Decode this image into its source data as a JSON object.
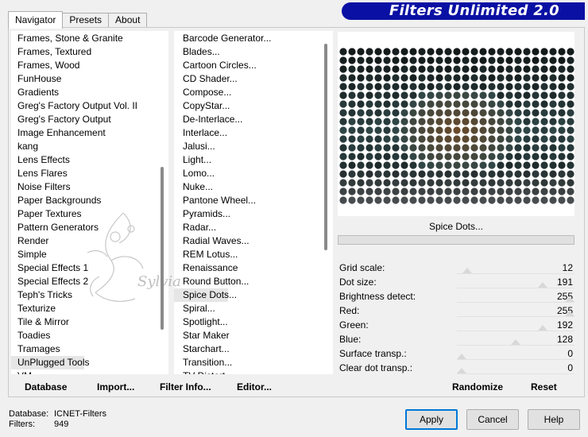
{
  "banner": {
    "title": "Filters Unlimited 2.0"
  },
  "tabs": [
    {
      "label": "Navigator",
      "active": true
    },
    {
      "label": "Presets",
      "active": false
    },
    {
      "label": "About",
      "active": false
    }
  ],
  "categories": [
    "Frames, Stone & Granite",
    "Frames, Textured",
    "Frames, Wood",
    "FunHouse",
    "Gradients",
    "Greg's Factory Output Vol. II",
    "Greg's Factory Output",
    "Image Enhancement",
    "kang",
    "Lens Effects",
    "Lens Flares",
    "Noise Filters",
    "Paper Backgrounds",
    "Paper Textures",
    "Pattern Generators",
    "Render",
    "Simple",
    "Special Effects 1",
    "Special Effects 2",
    "Teph's Tricks",
    "Texturize",
    "Tile & Mirror",
    "Toadies",
    "Tramages",
    "UnPlugged Tools",
    "VM..."
  ],
  "categories_selected": 24,
  "filters": [
    "Barcode Generator...",
    "Blades...",
    "Cartoon Circles...",
    "CD Shader...",
    "Compose...",
    "CopyStar...",
    "De-Interlace...",
    "Interlace...",
    "Jalusi...",
    "Light...",
    "Lomo...",
    "Nuke...",
    "Pantone Wheel...",
    "Pyramids...",
    "Radar...",
    "Radial Waves...",
    "REM Lotus...",
    "Renaissance",
    "Round Button...",
    "Spice Dots...",
    "Spiral...",
    "Spotlight...",
    "Star Maker",
    "Starchart...",
    "Transition...",
    "TV Distort..."
  ],
  "filters_selected": 19,
  "bottom_buttons": {
    "database": "Database",
    "import": "Import...",
    "filter_info": "Filter Info...",
    "editor": "Editor..."
  },
  "current_filter": "Spice Dots...",
  "params": [
    {
      "label": "Grid scale:",
      "value": "12",
      "level": 0.05
    },
    {
      "label": "Dot size:",
      "value": "191",
      "level": 0.75
    },
    {
      "label": "Brightness detect:",
      "value": "255",
      "level": 1.0
    },
    {
      "label": "Red:",
      "value": "255",
      "level": 1.0
    },
    {
      "label": "Green:",
      "value": "192",
      "level": 0.75
    },
    {
      "label": "Blue:",
      "value": "128",
      "level": 0.5
    },
    {
      "label": "Surface transp.:",
      "value": "0",
      "level": 0.0
    },
    {
      "label": "Clear dot transp.:",
      "value": "0",
      "level": 0.0
    }
  ],
  "right_buttons": {
    "randomize": "Randomize",
    "reset": "Reset"
  },
  "status": {
    "database_label": "Database:",
    "database_value": "ICNET-Filters",
    "filters_label": "Filters:",
    "filters_value": "949"
  },
  "dialog_buttons": {
    "apply": "Apply",
    "cancel": "Cancel",
    "help": "Help"
  },
  "colors": {
    "banner_bg": "#0a10a3",
    "dot_dark": "#141a1a",
    "dot_teal": "#2f4647",
    "dot_brown": "#6a4a2a",
    "dot_grey": "#55575a",
    "default_button_border": "#0078d7"
  },
  "watermark_signature": "Sylvia"
}
